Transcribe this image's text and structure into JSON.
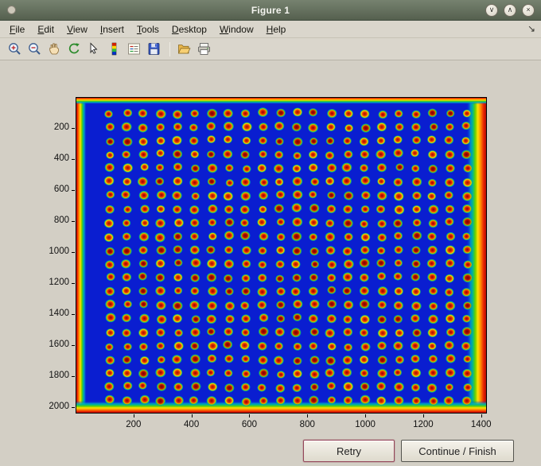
{
  "window": {
    "title": "Figure 1",
    "controls": [
      {
        "name": "minimize-button",
        "glyph": "∨"
      },
      {
        "name": "maximize-button",
        "glyph": "∧"
      },
      {
        "name": "close-button",
        "glyph": "×"
      }
    ]
  },
  "menu": {
    "items": [
      "File",
      "Edit",
      "View",
      "Insert",
      "Tools",
      "Desktop",
      "Window",
      "Help"
    ],
    "dock_glyph": "↘"
  },
  "toolbar": {
    "icons": [
      "zoom-in",
      "zoom-out",
      "pan",
      "rotate-3d",
      "data-cursor",
      "insert-colorbar",
      "insert-legend",
      "save",
      "separator",
      "open-file",
      "print"
    ]
  },
  "figure": {
    "x_ticks": [
      200,
      400,
      600,
      800,
      1000,
      1200,
      1400
    ],
    "y_ticks": [
      200,
      400,
      600,
      800,
      1000,
      1200,
      1400,
      1600,
      1800,
      2000
    ],
    "x_max": 1420,
    "y_max": 2040,
    "spot_grid": {
      "cols": 22,
      "rows": 22,
      "x_start": 118,
      "x_step": 58.7,
      "y_start": 105,
      "y_step": 88.2
    },
    "colors": {
      "field_blue": "#0a1ed0",
      "spot_core": "#8f0500",
      "spot_red": "#d41800",
      "spot_orange": "#f07800",
      "spot_yellow": "#ffd800",
      "spot_green": "#2db83c",
      "spot_cyan": "#00a8c0",
      "edge_dark_red": "#930b00",
      "edge_red": "#e82400",
      "edge_orange": "#ff8800",
      "edge_yellow": "#ffe100",
      "edge_green": "#63d000",
      "edge_teal": "#00b890",
      "retry_border": "#94475a",
      "continue_border": "#54544e"
    }
  },
  "buttons": {
    "retry": "Retry",
    "continue": "Continue / Finish"
  }
}
